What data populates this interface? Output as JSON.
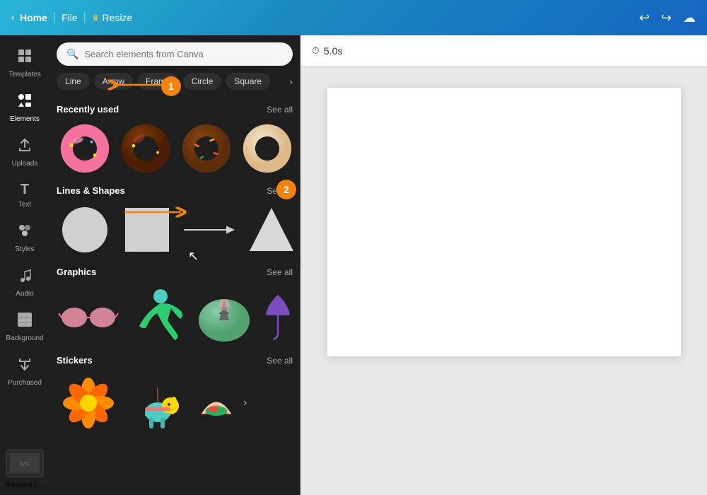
{
  "topbar": {
    "home_label": "Home",
    "file_label": "File",
    "resize_label": "Resize",
    "undo_icon": "↩",
    "redo_icon": "↪",
    "cloud_icon": "☁"
  },
  "sidebar": {
    "items": [
      {
        "id": "templates",
        "icon": "▦",
        "label": "Templates"
      },
      {
        "id": "elements",
        "icon": "✦",
        "label": "Elements"
      },
      {
        "id": "uploads",
        "icon": "⬆",
        "label": "Uploads"
      },
      {
        "id": "text",
        "icon": "T",
        "label": "Text"
      },
      {
        "id": "styles",
        "icon": "◈",
        "label": "Styles"
      },
      {
        "id": "audio",
        "icon": "♪",
        "label": "Audio"
      },
      {
        "id": "background",
        "icon": "▩",
        "label": "Background"
      },
      {
        "id": "purchased",
        "icon": "⬇",
        "label": "Purchased"
      }
    ],
    "bottom_label": "Blossom L..."
  },
  "search": {
    "placeholder": "Search elements from Canva",
    "annotation_number": "1"
  },
  "chips": {
    "items": [
      {
        "id": "line",
        "label": "Line"
      },
      {
        "id": "arrow",
        "label": "Arrow"
      },
      {
        "id": "frame",
        "label": "Frame"
      },
      {
        "id": "circle",
        "label": "Circle"
      },
      {
        "id": "square",
        "label": "Square"
      }
    ]
  },
  "recently_used": {
    "title": "Recently used",
    "see_all": "See all"
  },
  "lines_shapes": {
    "title": "Lines & Shapes",
    "see_all": "See all",
    "annotation_number": "2"
  },
  "graphics": {
    "title": "Graphics",
    "see_all": "See all"
  },
  "stickers": {
    "title": "Stickers",
    "see_all": "See all"
  },
  "canvas": {
    "time_label": "5.0s"
  },
  "colors": {
    "orange_accent": "#f5820a",
    "topbar_start": "#29b6d8",
    "topbar_end": "#1565c0"
  }
}
